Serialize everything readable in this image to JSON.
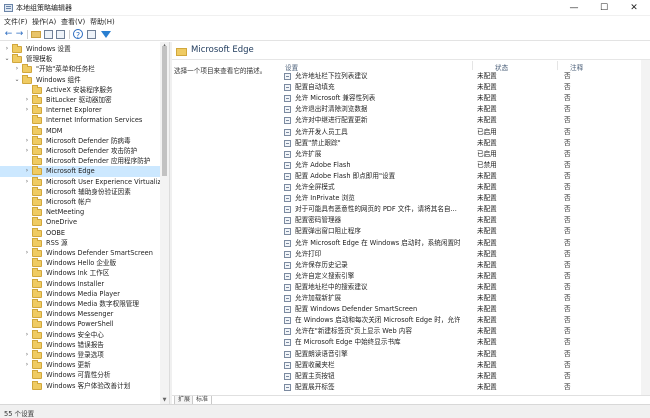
{
  "window": {
    "title": "本地组策略编辑器",
    "controls": {
      "minimize": "—",
      "maximize": "☐",
      "close": "✕"
    }
  },
  "menu": [
    "文件(F)",
    "操作(A)",
    "查看(V)",
    "帮助(H)"
  ],
  "tree": [
    {
      "label": "Windows 设置",
      "expanded": false,
      "selected": false
    },
    {
      "label": "管理模板",
      "expanded": true,
      "selected": false
    },
    {
      "label": "\"开始\"菜单和任务栏",
      "expanded": false,
      "selected": false
    },
    {
      "label": "Windows 组件",
      "expanded": true,
      "selected": false
    },
    {
      "label": "ActiveX 安装程序服务",
      "expanded": false,
      "selected": false
    },
    {
      "label": "BitLocker 驱动器加密",
      "expanded": false,
      "selected": false
    },
    {
      "label": "Internet Explorer",
      "expanded": false,
      "selected": false
    },
    {
      "label": "Internet Information Services",
      "expanded": false,
      "selected": false
    },
    {
      "label": "MDM",
      "expanded": false,
      "selected": false
    },
    {
      "label": "Microsoft Defender 防病毒",
      "expanded": false,
      "selected": false
    },
    {
      "label": "Microsoft Defender 攻击防护",
      "expanded": false,
      "selected": false
    },
    {
      "label": "Microsoft Defender 应用程序防护",
      "expanded": false,
      "selected": false
    },
    {
      "label": "Microsoft Edge",
      "expanded": false,
      "selected": true
    },
    {
      "label": "Microsoft User Experience Virtualiz",
      "expanded": false,
      "selected": false
    },
    {
      "label": "Microsoft 辅助身份验证因素",
      "expanded": false,
      "selected": false
    },
    {
      "label": "Microsoft 帐户",
      "expanded": false,
      "selected": false
    },
    {
      "label": "NetMeeting",
      "expanded": false,
      "selected": false
    },
    {
      "label": "OneDrive",
      "expanded": false,
      "selected": false
    },
    {
      "label": "OOBE",
      "expanded": false,
      "selected": false
    },
    {
      "label": "RSS 源",
      "expanded": false,
      "selected": false
    },
    {
      "label": "Windows Defender SmartScreen",
      "expanded": false,
      "selected": false
    },
    {
      "label": "Windows Hello 企业版",
      "expanded": false,
      "selected": false
    },
    {
      "label": "Windows Ink 工作区",
      "expanded": false,
      "selected": false
    },
    {
      "label": "Windows Installer",
      "expanded": false,
      "selected": false
    },
    {
      "label": "Windows Media Player",
      "expanded": false,
      "selected": false
    },
    {
      "label": "Windows Media 数字权限管理",
      "expanded": false,
      "selected": false
    },
    {
      "label": "Windows Messenger",
      "expanded": false,
      "selected": false
    },
    {
      "label": "Windows PowerShell",
      "expanded": false,
      "selected": false
    },
    {
      "label": "Windows 安全中心",
      "expanded": false,
      "selected": false
    },
    {
      "label": "Windows 错误报告",
      "expanded": false,
      "selected": false
    },
    {
      "label": "Windows 登录选项",
      "expanded": false,
      "selected": false
    },
    {
      "label": "Windows 更新",
      "expanded": false,
      "selected": false
    },
    {
      "label": "Windows 可靠性分析",
      "expanded": false,
      "selected": false
    },
    {
      "label": "Windows 客户体验改善计划",
      "expanded": false,
      "selected": false
    }
  ],
  "right": {
    "title": "Microsoft Edge",
    "description": "选择一个项目来查看它的描述。",
    "columns": {
      "setting": "设置",
      "state": "状态",
      "comment": "注释"
    },
    "rows": [
      {
        "name": "允许地址栏下拉列表建议",
        "state": "未配置",
        "comment": "否"
      },
      {
        "name": "配置自动填充",
        "state": "未配置",
        "comment": "否"
      },
      {
        "name": "允许 Microsoft 兼容性列表",
        "state": "未配置",
        "comment": "否"
      },
      {
        "name": "允许退出时清除浏览数据",
        "state": "未配置",
        "comment": "否"
      },
      {
        "name": "允许对中继进行配置更新",
        "state": "未配置",
        "comment": "否"
      },
      {
        "name": "允许开发人员工具",
        "state": "已启用",
        "comment": "否"
      },
      {
        "name": "配置\"禁止跟踪\"",
        "state": "未配置",
        "comment": "否"
      },
      {
        "name": "允许扩展",
        "state": "已启用",
        "comment": "否"
      },
      {
        "name": "允许 Adobe Flash",
        "state": "已禁用",
        "comment": "否"
      },
      {
        "name": "配置 Adobe Flash 即点即用\"设置",
        "state": "未配置",
        "comment": "否"
      },
      {
        "name": "允许全屏模式",
        "state": "未配置",
        "comment": "否"
      },
      {
        "name": "允许 InPrivate 浏览",
        "state": "未配置",
        "comment": "否"
      },
      {
        "name": "对于可能具有恶意性的网页的 PDF 文件，请将其名自...",
        "state": "未配置",
        "comment": "否"
      },
      {
        "name": "配置密码管理器",
        "state": "未配置",
        "comment": "否"
      },
      {
        "name": "配置弹出窗口阻止程序",
        "state": "未配置",
        "comment": "否"
      },
      {
        "name": "允许 Microsoft Edge 在 Windows 启动时，系统闲置时以...",
        "state": "未配置",
        "comment": "否"
      },
      {
        "name": "允许打印",
        "state": "未配置",
        "comment": "否"
      },
      {
        "name": "允许保存历史记录",
        "state": "未配置",
        "comment": "否"
      },
      {
        "name": "允许自定义搜索引擎",
        "state": "未配置",
        "comment": "否"
      },
      {
        "name": "配置地址栏中的搜索建议",
        "state": "未配置",
        "comment": "否"
      },
      {
        "name": "允许加载新扩展",
        "state": "未配置",
        "comment": "否"
      },
      {
        "name": "配置 Windows Defender SmartScreen",
        "state": "未配置",
        "comment": "否"
      },
      {
        "name": "在 Windows 启动和每次关闭 Microsoft Edge 时，允许 ...",
        "state": "未配置",
        "comment": "否"
      },
      {
        "name": "允许在\"新建标签页\"页上显示 Web 内容",
        "state": "未配置",
        "comment": "否"
      },
      {
        "name": "在 Microsoft Edge 中始终显示书库",
        "state": "未配置",
        "comment": "否"
      },
      {
        "name": "配置朗读语音引擎",
        "state": "未配置",
        "comment": "否"
      },
      {
        "name": "配置收藏夹栏",
        "state": "未配置",
        "comment": "否"
      },
      {
        "name": "配置主页按钮",
        "state": "未配置",
        "comment": "否"
      },
      {
        "name": "配置展开标签",
        "state": "未配置",
        "comment": "否"
      }
    ]
  },
  "tabs": [
    "扩展",
    "标准"
  ],
  "status": "55 个设置"
}
